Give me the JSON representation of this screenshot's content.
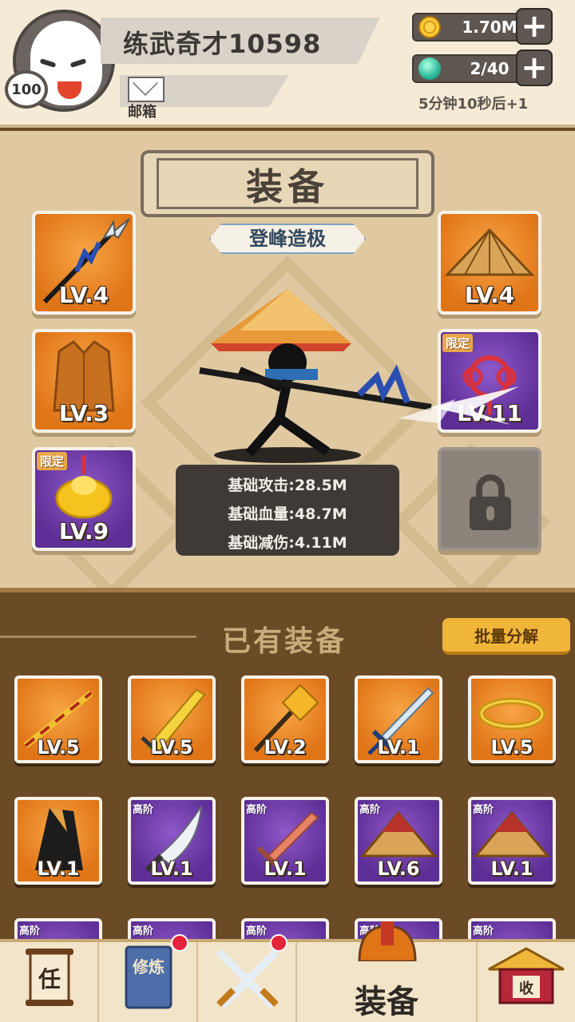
{
  "player": {
    "name": "练武奇才10598",
    "level": "100",
    "mailbox_label": "邮箱"
  },
  "resources": {
    "coins": "1.70M",
    "energy": "2/40",
    "energy_timer": "5分钟10秒后+1"
  },
  "equip_panel": {
    "title": "装备",
    "rank_label": "登峰造极",
    "slots": [
      {
        "level": "LV.4",
        "tag": ""
      },
      {
        "level": "LV.4",
        "tag": ""
      },
      {
        "level": "LV.3",
        "tag": ""
      },
      {
        "level": "LV.11",
        "tag": "限定"
      },
      {
        "level": "LV.9",
        "tag": "限定"
      }
    ],
    "stats": {
      "attack": "基础攻击:28.5M",
      "hp": "基础血量:48.7M",
      "damage_reduction": "基础减伤:4.11M"
    }
  },
  "owned": {
    "title": "已有装备",
    "bulk_button": "批量分解",
    "items": [
      {
        "level": "LV.5",
        "tag": ""
      },
      {
        "level": "LV.5",
        "tag": ""
      },
      {
        "level": "LV.2",
        "tag": ""
      },
      {
        "level": "LV.1",
        "tag": ""
      },
      {
        "level": "LV.5",
        "tag": ""
      },
      {
        "level": "LV.1",
        "tag": ""
      },
      {
        "level": "LV.1",
        "tag": "高阶"
      },
      {
        "level": "LV.1",
        "tag": "高阶"
      },
      {
        "level": "LV.6",
        "tag": "高阶"
      },
      {
        "level": "LV.1",
        "tag": "高阶"
      },
      {
        "level": "",
        "tag": "高阶"
      },
      {
        "level": "",
        "tag": "高阶"
      },
      {
        "level": "",
        "tag": "高阶"
      },
      {
        "level": "",
        "tag": "高阶"
      },
      {
        "level": "",
        "tag": "高阶"
      }
    ]
  },
  "nav": {
    "task_icon_text": "任",
    "cultivate_icon_text": "修炼",
    "equip_label": "装备",
    "collect_icon_text": "收"
  },
  "colors": {
    "orange_rarity": "#e07518",
    "purple_rarity": "#5d2e96",
    "accent_button": "#f0b63a"
  }
}
